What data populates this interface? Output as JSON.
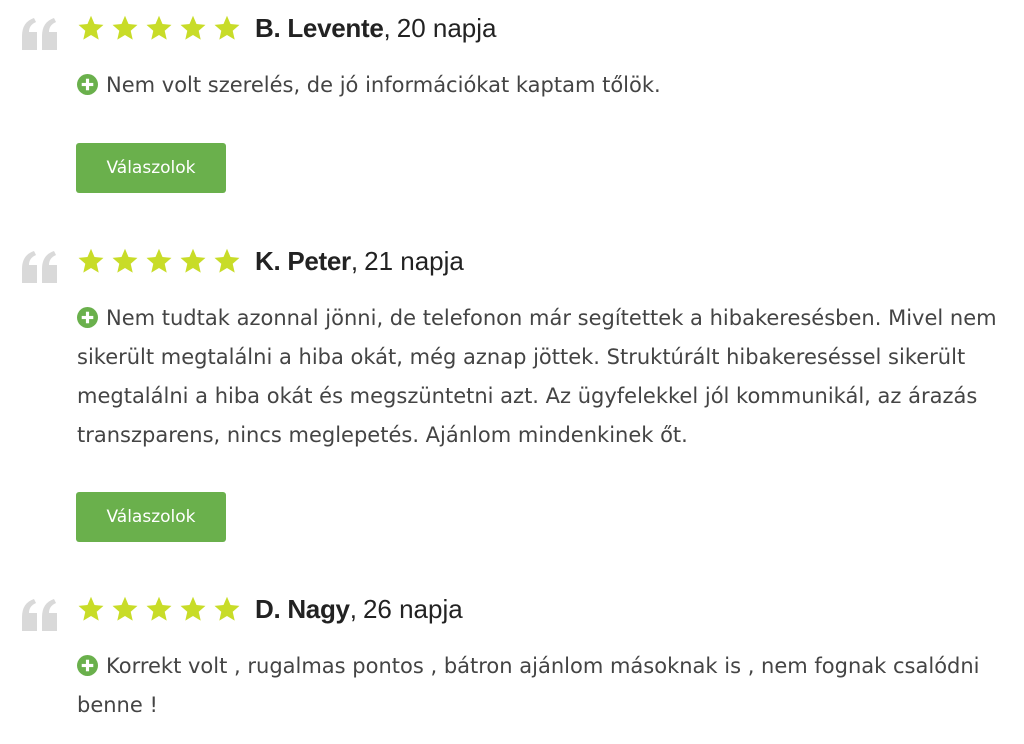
{
  "colors": {
    "star": "#c8dc28",
    "button": "#6ab04c",
    "plus_icon": "#6ab04c",
    "quote_mark": "#d9d9d9"
  },
  "icons": {
    "quote": "quote-icon",
    "star": "star-icon",
    "pro": "plus-circle-icon"
  },
  "reviews": [
    {
      "rating": 5,
      "author": "B. Levente",
      "separator": ",",
      "time": "20 napja",
      "text": "Nem volt szerelés, de jó információkat kaptam tőlök.",
      "reply_label": "Válaszolok"
    },
    {
      "rating": 5,
      "author": "K. Peter",
      "separator": ",",
      "time": "21 napja",
      "text": "Nem tudtak azonnal jönni, de telefonon már segítettek a hibakeresésben. Mivel nem sikerült megtalálni a hiba okát, még aznap jöttek. Struktúrált hibakereséssel sikerült megtalálni a hiba okát és megszüntetni azt. Az ügyfelekkel jól kommunikál, az árazás transzparens, nincs meglepetés. Ajánlom mindenkinek őt.",
      "reply_label": "Válaszolok"
    },
    {
      "rating": 5,
      "author": "D. Nagy",
      "separator": ",",
      "time": "26 napja",
      "text": "Korrekt volt , rugalmas pontos , bátron ajánlom másoknak is , nem fognak csalódni benne !"
    }
  ]
}
